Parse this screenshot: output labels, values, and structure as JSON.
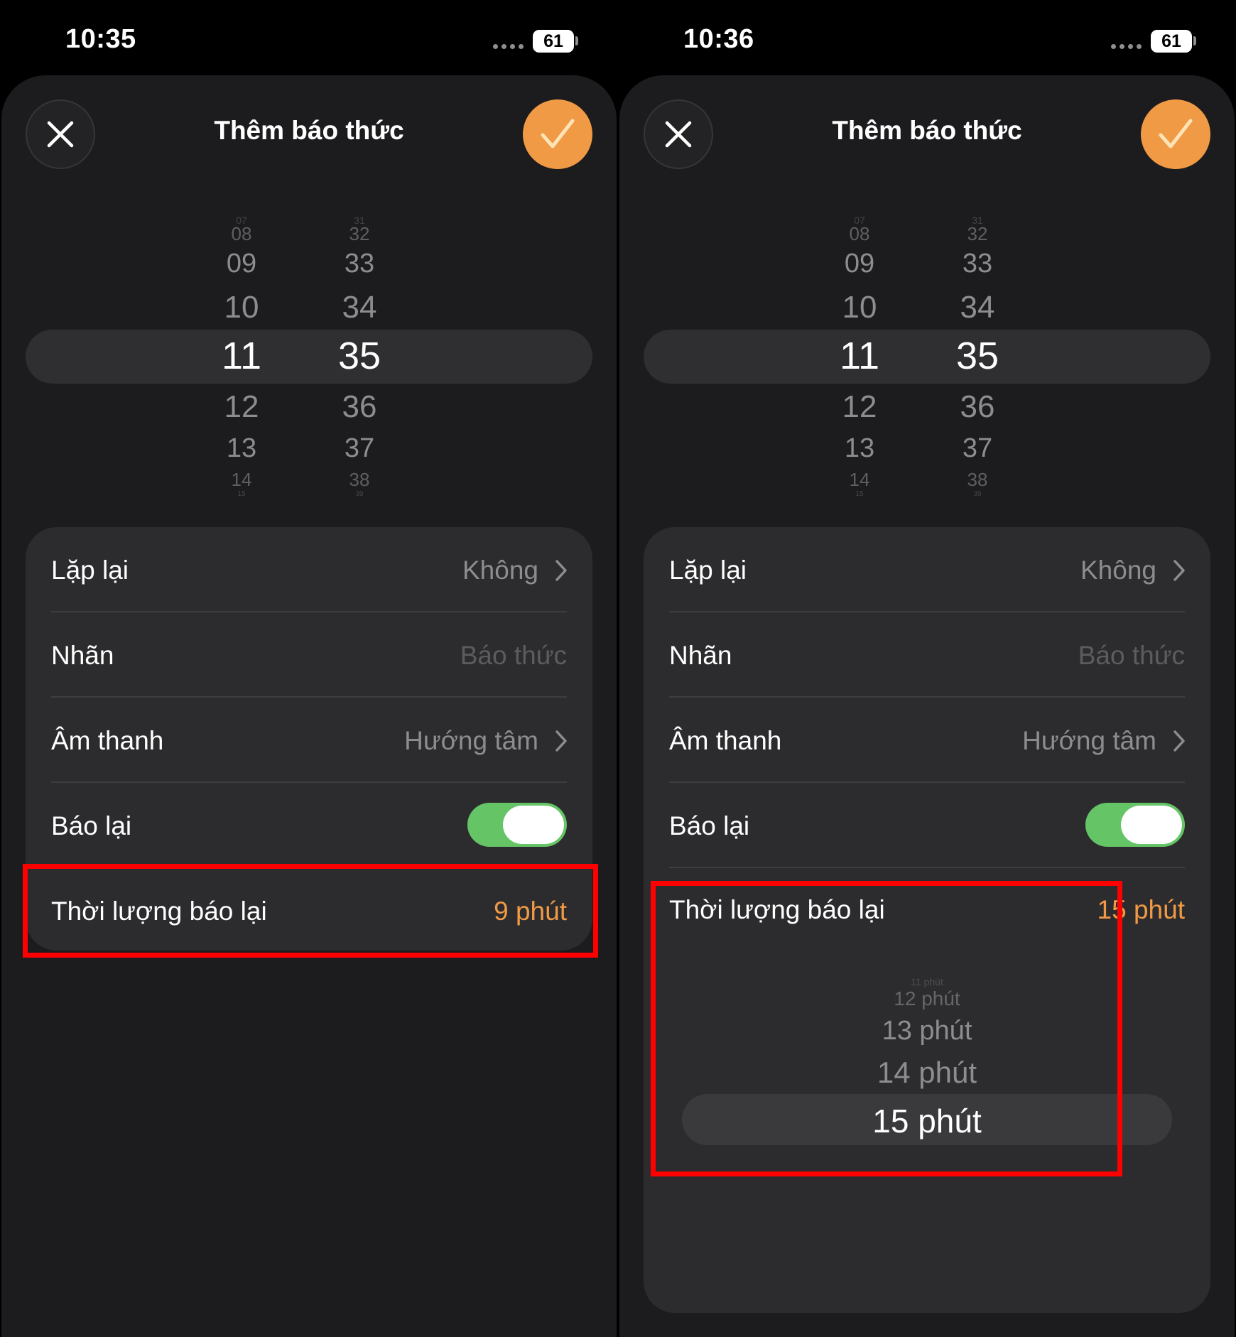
{
  "screens": [
    {
      "status": {
        "time": "10:35",
        "battery": "61"
      },
      "header": {
        "title": "Thêm báo thức",
        "close_icon": "close-icon",
        "confirm_icon": "checkmark-icon"
      },
      "picker": {
        "hours": [
          "07",
          "08",
          "09",
          "10",
          "11",
          "12",
          "13",
          "14",
          "15"
        ],
        "minutes": [
          "31",
          "32",
          "33",
          "34",
          "35",
          "36",
          "37",
          "38",
          "39"
        ],
        "selected_hour": "11",
        "selected_minute": "35"
      },
      "settings": {
        "repeat": {
          "label": "Lặp lại",
          "value": "Không"
        },
        "label": {
          "label": "Nhãn",
          "placeholder": "Báo thức"
        },
        "sound": {
          "label": "Âm thanh",
          "value": "Hướng tâm"
        },
        "snooze": {
          "label": "Báo lại",
          "enabled": true
        },
        "snooze_duration": {
          "label": "Thời lượng báo lại",
          "value": "9 phút"
        }
      }
    },
    {
      "status": {
        "time": "10:36",
        "battery": "61"
      },
      "header": {
        "title": "Thêm báo thức",
        "close_icon": "close-icon",
        "confirm_icon": "checkmark-icon"
      },
      "picker": {
        "hours": [
          "07",
          "08",
          "09",
          "10",
          "11",
          "12",
          "13",
          "14",
          "15"
        ],
        "minutes": [
          "31",
          "32",
          "33",
          "34",
          "35",
          "36",
          "37",
          "38",
          "39"
        ],
        "selected_hour": "11",
        "selected_minute": "35"
      },
      "settings": {
        "repeat": {
          "label": "Lặp lại",
          "value": "Không"
        },
        "label": {
          "label": "Nhãn",
          "placeholder": "Báo thức"
        },
        "sound": {
          "label": "Âm thanh",
          "value": "Hướng tâm"
        },
        "snooze": {
          "label": "Báo lại",
          "enabled": true
        },
        "snooze_duration": {
          "label": "Thời lượng báo lại",
          "value": "15 phút",
          "options": [
            "11 phút",
            "12 phút",
            "13 phút",
            "14 phút",
            "15 phút"
          ],
          "selected": "15 phút"
        }
      }
    }
  ],
  "colors": {
    "accent": "#f19a45",
    "toggle_on": "#65c466",
    "highlight": "#ff0000",
    "sheet": "#1c1c1e",
    "card": "#2c2c2e"
  }
}
